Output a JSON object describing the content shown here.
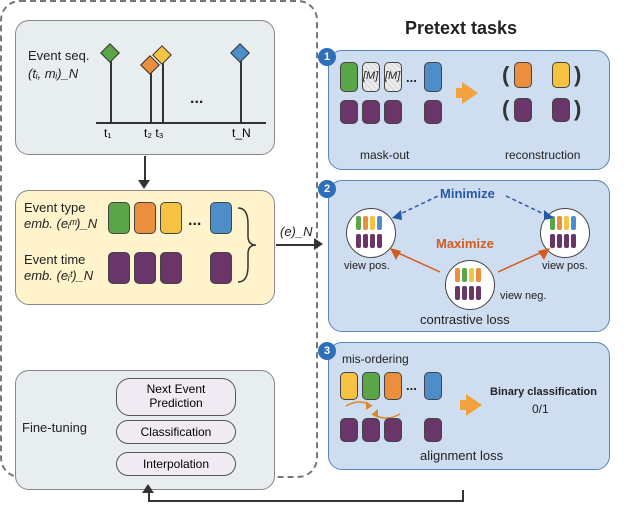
{
  "seq": {
    "title_line1": "Event seq.",
    "title_line2": "(tᵢ, mᵢ)_N",
    "ticks": [
      "t₁",
      "t₂ t₃",
      "t_N"
    ],
    "ellipsis": "..."
  },
  "emb": {
    "type_line1": "Event type",
    "type_line2": "emb. (eᵢᵐ)_N",
    "time_line1": "Event time",
    "time_line2": "emb. (eᵢᵗ)_N",
    "ellipsis": "..."
  },
  "arrow_emb_label": "(e)_N",
  "finetune": {
    "title": "Fine-tuning",
    "items": [
      "Next Event\nPrediction",
      "Classification",
      "Interpolation"
    ]
  },
  "pretext": {
    "title": "Pretext tasks",
    "task1": {
      "mask_label": "[M]",
      "ellipsis": "...",
      "mask_out": "mask-out",
      "reconstruction": "reconstruction"
    },
    "task2": {
      "minimize": "Minimize",
      "maximize": "Maximize",
      "view_pos": "view pos.",
      "view_neg": "view neg.",
      "caption": "contrastive loss"
    },
    "task3": {
      "misorder": "mis-ordering",
      "ellipsis": "...",
      "binary": "Binary classification",
      "zero_one": "0/1",
      "caption": "alignment loss"
    }
  }
}
